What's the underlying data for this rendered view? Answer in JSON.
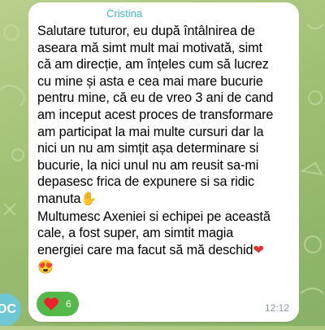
{
  "chat": {
    "avatar_initials": "DC",
    "sender": "Cristina",
    "message_lines": [
      "Salutare tuturor, eu după întâlnirea de",
      "aseara mă simt mult mai motivată,  simt",
      "că am direcție,  am înțeles cum să lucrez",
      "cu mine și asta e cea mai mare bucurie",
      "pentru mine, că eu de vreo 3 ani de cand",
      "am inceput acest proces de transformare",
      "am participat la mai multe cursuri dar la",
      "nici un nu am simțit așa determinare si",
      "bucurie, la nici unul nu am reusit sa-mi",
      "depasesc frica de expunere si sa ridic",
      "manuta",
      "Multumesc Axeniei si echipei pe această",
      "cale, a fost super, am simtit magia",
      "energiei care ma facut să mă deschid"
    ],
    "reaction": {
      "icon": "heart",
      "count": "6"
    },
    "time": "12:12",
    "colors": {
      "sender": "#3fb3cc",
      "reaction_bg": "#55b84a",
      "bubble": "#ffffff"
    }
  }
}
